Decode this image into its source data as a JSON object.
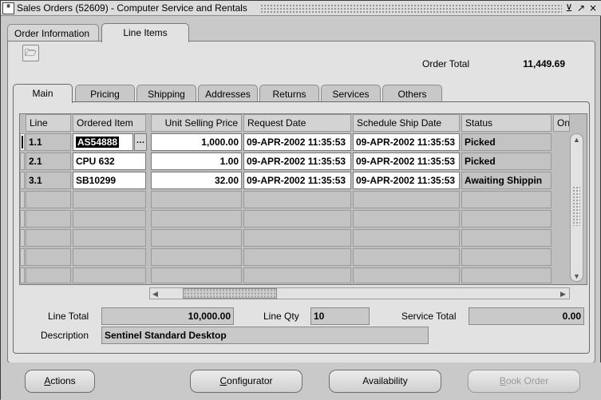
{
  "window": {
    "title": "Sales Orders (52609) - Computer Service and Rentals",
    "icon_text": "ORACLE",
    "buttons": [
      {
        "name": "minimize",
        "glyph": "⊻"
      },
      {
        "name": "maximize",
        "glyph": "↗"
      },
      {
        "name": "close",
        "glyph": "×"
      }
    ]
  },
  "top_tabs": [
    {
      "label": "Order Information",
      "active": false
    },
    {
      "label": "Line Items",
      "active": true
    }
  ],
  "toolbar": {
    "folder_icon": "folder-icon",
    "folder_glyph": "🗁"
  },
  "order_total": {
    "label": "Order Total",
    "value": "11,449.69"
  },
  "inner_tabs": [
    {
      "label": "Main",
      "active": true
    },
    {
      "label": "Pricing",
      "active": false
    },
    {
      "label": "Shipping",
      "active": false
    },
    {
      "label": "Addresses",
      "active": false
    },
    {
      "label": "Returns",
      "active": false
    },
    {
      "label": "Services",
      "active": false
    },
    {
      "label": "Others",
      "active": false
    }
  ],
  "table": {
    "columns": [
      "Line",
      "Ordered Item",
      "Unit Selling Price",
      "Request Date",
      "Schedule Ship Date",
      "Status",
      "On"
    ],
    "rows": [
      {
        "line": "1.1",
        "item": "AS54888",
        "price": "1,000.00",
        "request_date": "09-APR-2002 11:35:53",
        "ship_date": "09-APR-2002 11:35:53",
        "status": "Picked"
      },
      {
        "line": "2.1",
        "item": "CPU 632",
        "price": "1.00",
        "request_date": "09-APR-2002 11:35:53",
        "ship_date": "09-APR-2002 11:35:53",
        "status": "Picked"
      },
      {
        "line": "3.1",
        "item": "SB10299",
        "price": "32.00",
        "request_date": "09-APR-2002 11:35:53",
        "ship_date": "09-APR-2002 11:35:53",
        "status": "Awaiting Shippin"
      }
    ],
    "lov_glyph": "…"
  },
  "scroll": {
    "up": "▲",
    "down": "▼",
    "left": "◀",
    "right": "▶"
  },
  "summary": {
    "line_total_label": "Line Total",
    "line_total_value": "10,000.00",
    "line_qty_label": "Line Qty",
    "line_qty_value": "10",
    "service_total_label": "Service Total",
    "service_total_value": "0.00",
    "description_label": "Description",
    "description_value": "Sentinel Standard Desktop"
  },
  "buttons": {
    "actions_first": "A",
    "actions_rest": "ctions",
    "configurator_first": "C",
    "configurator_rest": "onfigurator",
    "availability_first": "Availability",
    "book_first": "B",
    "book_rest": "ook Order"
  }
}
